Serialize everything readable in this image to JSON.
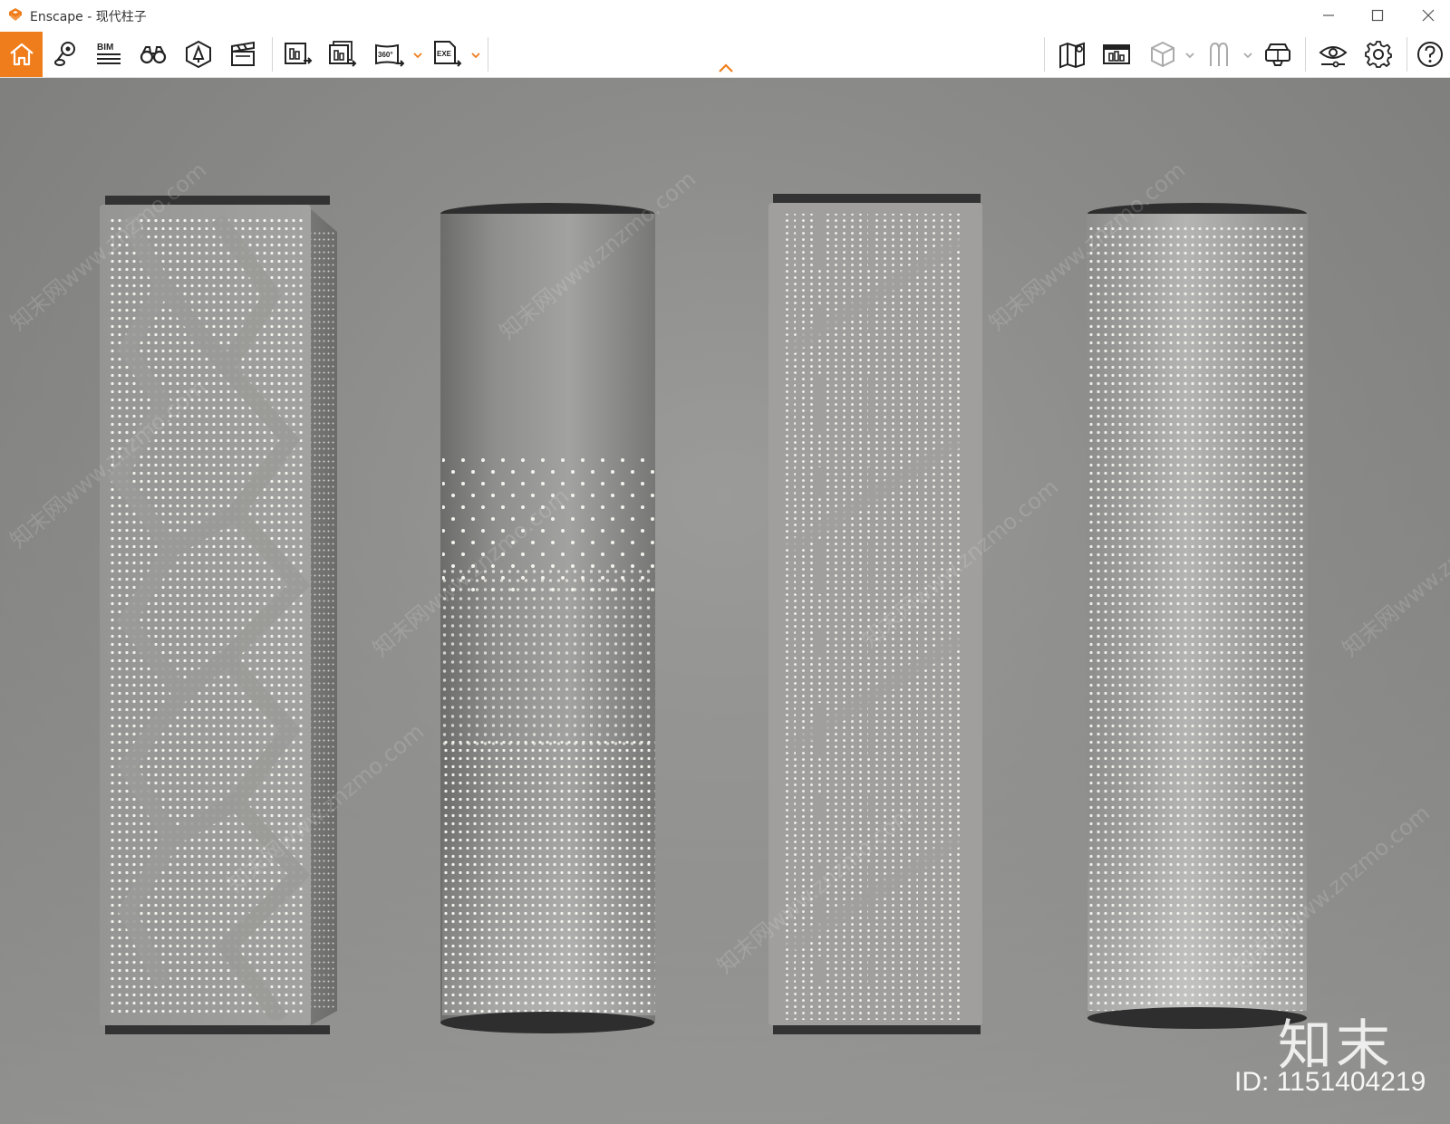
{
  "window": {
    "title": "Enscape - 现代柱子",
    "accent_color": "#f07d1b",
    "controls": [
      "minimize-icon",
      "maximize-icon",
      "close-icon"
    ]
  },
  "toolbar": {
    "left_buttons": [
      {
        "name": "home",
        "icon": "home-icon",
        "active": true
      },
      {
        "name": "views",
        "icon": "map-pin-icon"
      },
      {
        "name": "bim",
        "icon": "bim-icon",
        "label": "BIM"
      },
      {
        "name": "explore",
        "icon": "binoculars-icon"
      },
      {
        "name": "assets",
        "icon": "asset-library-icon"
      },
      {
        "name": "video",
        "icon": "clapperboard-icon"
      },
      {
        "name": "screenshot",
        "icon": "render-image-icon"
      },
      {
        "name": "batch-render",
        "icon": "batch-render-icon"
      },
      {
        "name": "panorama",
        "icon": "panorama-icon",
        "label": "360°"
      },
      {
        "name": "export-exe",
        "icon": "export-exe-icon",
        "label": "EXE"
      }
    ],
    "right_buttons": [
      {
        "name": "map",
        "icon": "map-icon"
      },
      {
        "name": "atmosphere",
        "icon": "atmosphere-icon"
      },
      {
        "name": "section-box",
        "icon": "cube-icon"
      },
      {
        "name": "walkthrough",
        "icon": "figure-icon"
      },
      {
        "name": "vr",
        "icon": "vr-headset-icon"
      },
      {
        "name": "visual-settings",
        "icon": "eye-icon"
      },
      {
        "name": "settings",
        "icon": "gear-icon"
      },
      {
        "name": "help",
        "icon": "help-icon"
      }
    ]
  },
  "viewport": {
    "scene": "four perforated columns",
    "watermark_logo": "知末",
    "watermark_id": "ID: 1151404219",
    "watermark_repeat": "知末网www.znzmo.com"
  }
}
